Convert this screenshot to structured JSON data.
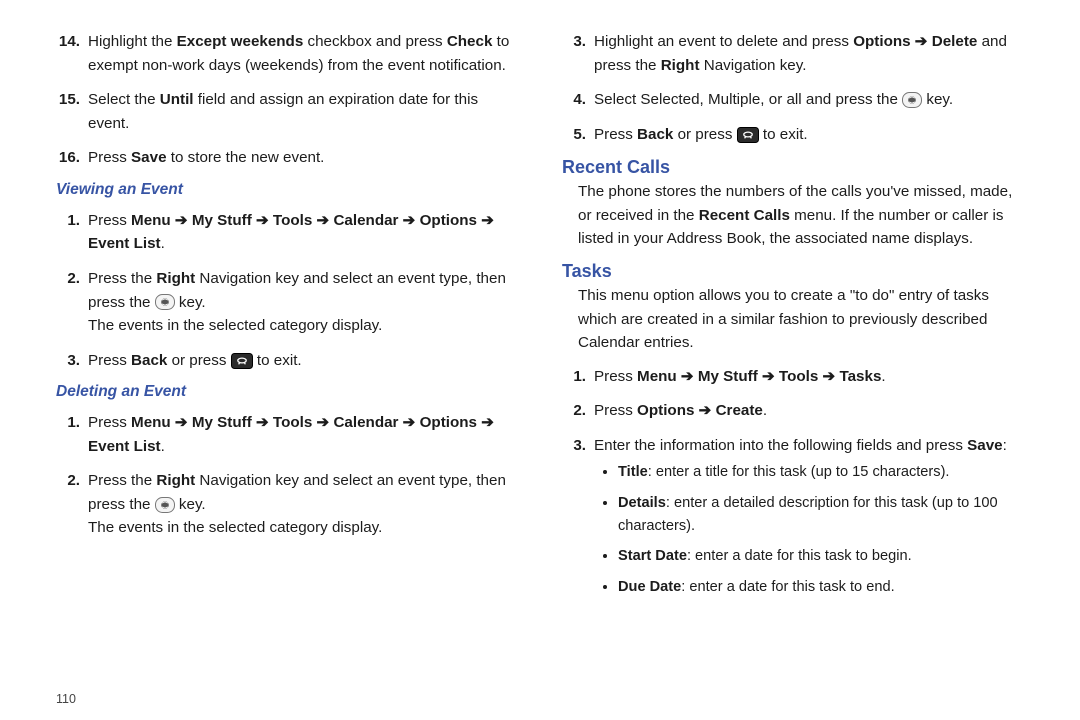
{
  "left": {
    "s14": {
      "num": "14.",
      "pre": "Highlight the ",
      "b1": "Except weekends",
      "mid": " checkbox and press ",
      "b2": "Check",
      "post": " to exempt non-work days (weekends) from the event notification."
    },
    "s15": {
      "num": "15.",
      "pre": "Select the ",
      "b1": "Until",
      "post": " field and assign an expiration date for this event."
    },
    "s16": {
      "num": "16.",
      "pre": "Press ",
      "b1": "Save",
      "post": " to store the new event."
    },
    "viewing_h": "Viewing an Event",
    "v1": {
      "num": "1.",
      "pre": "Press ",
      "b1": "Menu ➔ My Stuff ➔ Tools ➔ Calendar ➔ Options ➔ Event List",
      "post": "."
    },
    "v2": {
      "num": "2.",
      "pre": "Press the ",
      "b1": "Right",
      "mid": " Navigation key and select an event type, then press the ",
      "icon": "select",
      "post": " key.",
      "line2": "The events in the selected category display."
    },
    "v3": {
      "num": "3.",
      "pre": "Press ",
      "b1": "Back",
      "mid": " or press ",
      "icon": "end",
      "post": " to exit."
    },
    "deleting_h": "Deleting an Event",
    "d1": {
      "num": "1.",
      "pre": "Press ",
      "b1": "Menu ➔ My Stuff ➔ Tools ➔ Calendar ➔ Options ➔ Event List",
      "post": "."
    },
    "d2": {
      "num": "2.",
      "pre": "Press the ",
      "b1": "Right",
      "mid": " Navigation key and select an event type, then press the ",
      "icon": "select",
      "post": " key.",
      "line2": "The events in the selected category display."
    }
  },
  "right": {
    "s3": {
      "num": "3.",
      "pre": "Highlight an event to delete and press ",
      "b1": "Options ➔ Delete",
      "mid": " and press the ",
      "b2": "Right",
      "post": " Navigation key."
    },
    "s4": {
      "num": "4.",
      "pre": "Select Selected, Multiple, or all and press the ",
      "icon": "select",
      "post": " key."
    },
    "s5": {
      "num": "5.",
      "pre": "Press ",
      "b1": "Back",
      "mid": " or press ",
      "icon": "end",
      "post": " to exit."
    },
    "recent_h": "Recent Calls",
    "recent_body_pre": "The phone stores the numbers of the calls you've missed, made, or received in the ",
    "recent_body_b": "Recent Calls",
    "recent_body_post": " menu. If the number or caller is listed in your Address Book, the associated name displays.",
    "tasks_h": "Tasks",
    "tasks_body": "This menu option allows you to create a \"to do\" entry of tasks which are created in a similar fashion to previously described Calendar entries.",
    "t1": {
      "num": "1.",
      "pre": "Press ",
      "b1": "Menu ➔ My Stuff ➔ Tools ➔ Tasks",
      "post": "."
    },
    "t2": {
      "num": "2.",
      "pre": "Press ",
      "b1": "Options  ➔ Create",
      "post": "."
    },
    "t3": {
      "num": "3.",
      "pre": "Enter the information into the following fields and press ",
      "b1": "Save",
      "post": ":"
    },
    "bul": [
      {
        "b": "Title",
        "t": ": enter a title for this task (up to 15 characters)."
      },
      {
        "b": "Details",
        "t": ": enter a detailed description for this task (up to 100 characters)."
      },
      {
        "b": "Start Date",
        "t": ": enter a date for this task to begin."
      },
      {
        "b": "Due Date",
        "t": ": enter a date for this task to end."
      }
    ]
  },
  "pagenum": "110"
}
